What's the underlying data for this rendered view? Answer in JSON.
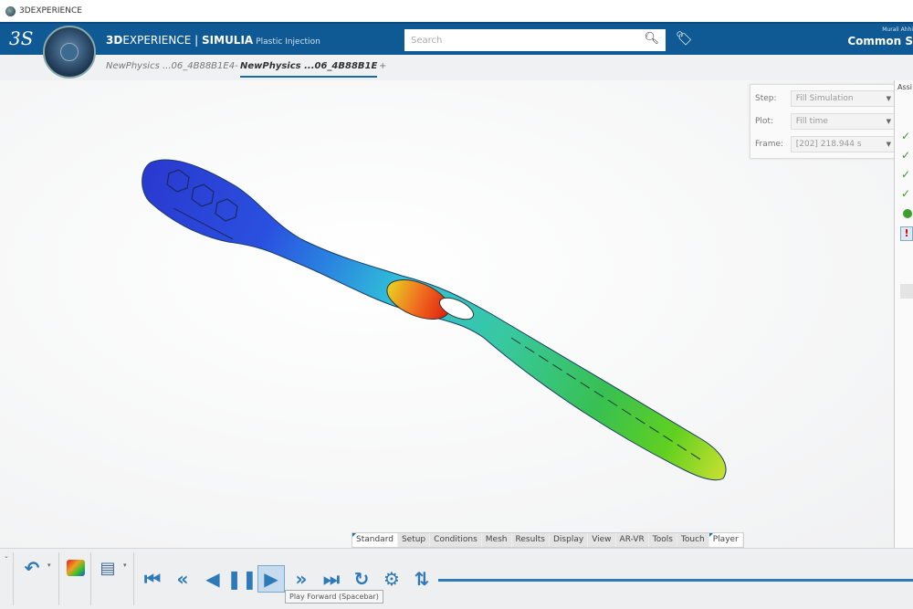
{
  "window": {
    "title": "3DEXPERIENCE"
  },
  "header": {
    "brand_bold": "3D",
    "brand_rest": "EXPERIENCE | ",
    "app": "SIMULIA",
    "app_sub": "Plastic Injection",
    "search_placeholder": "Search",
    "user_name": "Murali Ahhi",
    "workspace": "Common S"
  },
  "tabs": [
    {
      "label": "NewPhysics ...06_4B88B1E4-",
      "active": false
    },
    {
      "label": "NewPhysics ...06_4B88B1E",
      "active": true
    }
  ],
  "results_panel": {
    "step": {
      "label": "Step:",
      "value": "Fill Simulation"
    },
    "plot": {
      "label": "Plot:",
      "value": "Fill time"
    },
    "frame": {
      "label": "Frame:",
      "value": "[202]    218.944 s"
    }
  },
  "assistant": {
    "title": "Assi",
    "status": [
      "done",
      "done",
      "done",
      "done",
      "current",
      "error"
    ]
  },
  "section_tabs": [
    "Standard",
    "Setup",
    "Conditions",
    "Mesh",
    "Results",
    "Display",
    "View",
    "AR-VR",
    "Tools",
    "Touch",
    "Player"
  ],
  "active_section": "Player",
  "player": {
    "buttons": [
      "first-frame",
      "fast-backward",
      "play-backward",
      "pause",
      "play-forward",
      "fast-forward",
      "last-frame",
      "loop",
      "settings",
      "swap"
    ],
    "tooltip": "Play Forward (Spacebar)"
  },
  "colors": {
    "header": "#0f5a94",
    "accent": "#2e7ab8"
  }
}
